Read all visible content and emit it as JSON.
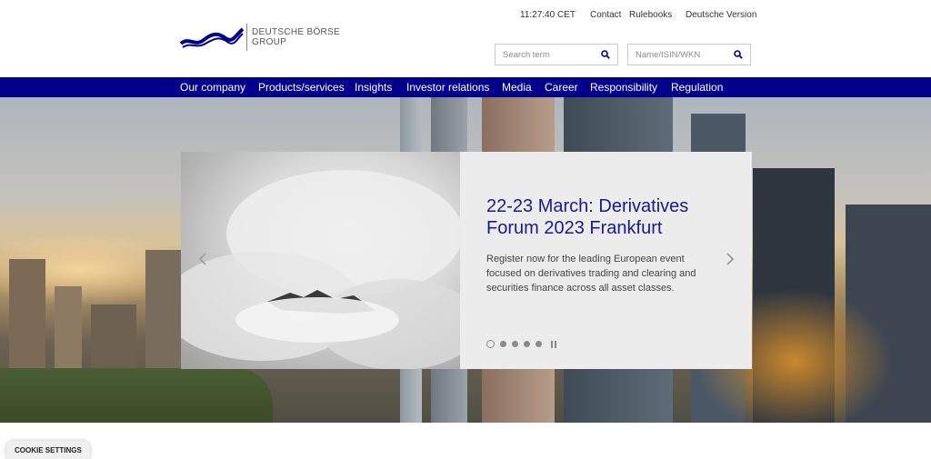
{
  "header": {
    "logo": {
      "line1": "DEUTSCHE BÖRSE",
      "line2": "GROUP"
    },
    "time": "11:27:40 CET",
    "links": {
      "contact": "Contact",
      "rulebooks": "Rulebooks",
      "language": "Deutsche Version"
    },
    "search": {
      "placeholder": "Search term"
    },
    "isin_search": {
      "placeholder": "Name/ISIN/WKN"
    }
  },
  "nav": {
    "items": [
      {
        "label": "Our company"
      },
      {
        "label": "Products/services"
      },
      {
        "label": "Insights"
      },
      {
        "label": "Investor relations"
      },
      {
        "label": "Media"
      },
      {
        "label": "Career"
      },
      {
        "label": "Responsibility"
      },
      {
        "label": "Regulation"
      }
    ]
  },
  "slider": {
    "title": "22-23 March: Derivatives Forum 2023 Frankfurt",
    "text": "Register now for the leading European event focused on derivatives trading and clearing and securities finance across all asset classes.",
    "slide_count": 5,
    "active_index": 0
  },
  "cookie": {
    "label": "COOKIE SETTINGS"
  },
  "colors": {
    "brand_blue": "#00008b",
    "title_blue": "#1a1a8c"
  }
}
